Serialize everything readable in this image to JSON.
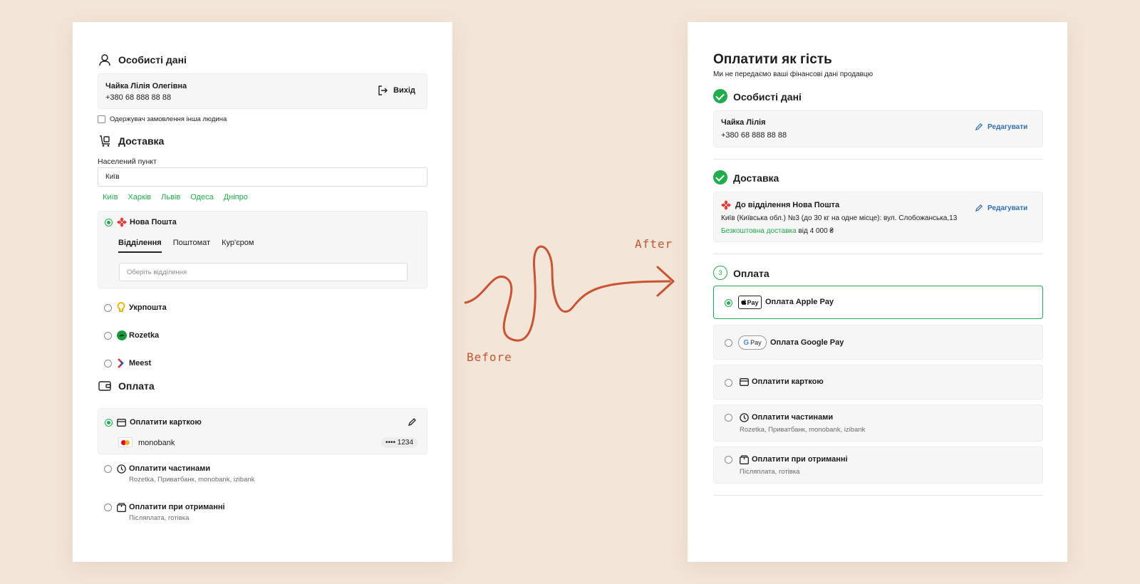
{
  "before": {
    "personal": {
      "title": "Особисті дані",
      "name": "Чайка Лілія Олегівна",
      "phone": "+380 68 888 88 88",
      "logout_label": "Вихід",
      "other_recipient_label": "Одержувач замовлення інша людина"
    },
    "delivery": {
      "title": "Доставка",
      "city_label": "Населений пункт",
      "city_value": "Київ",
      "city_chips": [
        "Київ",
        "Харків",
        "Львів",
        "Одеса",
        "Дніпро"
      ],
      "carriers": [
        {
          "name": "Нова Пошта",
          "selected": true
        },
        {
          "name": "Укрпошта",
          "selected": false
        },
        {
          "name": "Rozetka",
          "selected": false
        },
        {
          "name": "Meest",
          "selected": false
        }
      ],
      "tabs": [
        "Відділення",
        "Поштомат",
        "Кур'єром"
      ],
      "active_tab": "Відділення",
      "branch_placeholder": "Оберіть відділення"
    },
    "payment": {
      "title": "Оплата",
      "card_label": "Оплатити карткою",
      "card_bank": "monobank",
      "card_number": "•••• 1234",
      "parts_label": "Оплатити частинами",
      "parts_sub": "Rozetka, Приватбанк, monobank, izibank",
      "on_receipt_label": "Оплатити при отриманні",
      "on_receipt_sub": "Післяплата, готівка"
    }
  },
  "after": {
    "title": "Оплатити як гість",
    "subtitle": "Ми не передаємо ваші фінансові дані продавцю",
    "personal": {
      "title": "Особисті дані",
      "name": "Чайка Лілія",
      "phone": "+380 68 888 88 88",
      "edit_label": "Редагувати"
    },
    "delivery": {
      "title": "Доставка",
      "method": "До відділення Нова Пошта",
      "address": "Київ (Київська обл.) №3 (до 30 кг на одне місце): вул. Слобожанська,13",
      "free_label": "Безкоштовна доставка",
      "free_from": "від 4 000 ₴",
      "edit_label": "Редагувати"
    },
    "payment": {
      "step": "3",
      "title": "Оплата",
      "apple_badge": "Pay",
      "apple_label": "Оплата Apple Pay",
      "google_badge": "Pay",
      "google_label": "Оплата Google Pay",
      "card_label": "Оплатити карткою",
      "parts_label": "Оплатити частинами",
      "parts_sub": "Rozetka, Приватбанк, monobank, izibank",
      "on_receipt_label": "Оплатити при отриманні",
      "on_receipt_sub": "Післяплата, готівка"
    }
  },
  "annotations": {
    "before": "Before",
    "after": "After"
  },
  "colors": {
    "accent_green": "#1fae4b",
    "arrow": "#c95434",
    "background": "#f3e5d8",
    "edit_blue": "#2f6fb6"
  }
}
